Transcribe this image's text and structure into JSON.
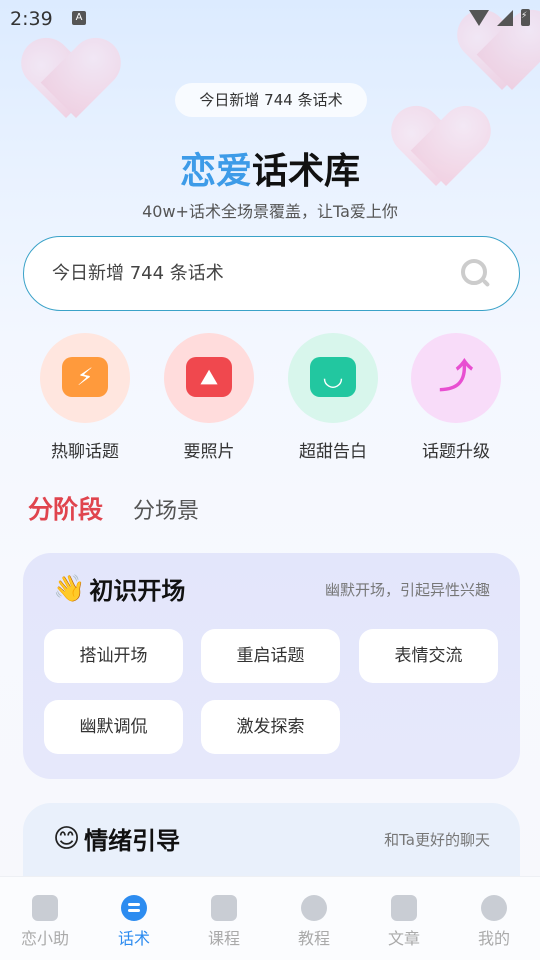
{
  "status_bar": {
    "time": "2:39",
    "indicator": "A"
  },
  "header": {
    "badge": "今日新增 744 条话术",
    "title_accent": "恋爱",
    "title_rest": "话术库",
    "subtitle": "40w+话术全场景覆盖，让Ta爱上你"
  },
  "search": {
    "placeholder": "今日新增 744 条话术"
  },
  "quick_actions": [
    {
      "label": "热聊话题",
      "icon": "lightning-chat-icon",
      "color": "#ff9a3c",
      "bg": "#ffe6df"
    },
    {
      "label": "要照片",
      "icon": "photo-icon",
      "color": "#f0484e",
      "bg": "#ffdcdc"
    },
    {
      "label": "超甜告白",
      "icon": "smile-chat-icon",
      "color": "#22c7a0",
      "bg": "#d8f6ec"
    },
    {
      "label": "话题升级",
      "icon": "upgrade-arrow-icon",
      "color": "#e84fd1",
      "bg": "#f8dcf9"
    }
  ],
  "tabs": {
    "active": "分阶段",
    "inactive": "分场景"
  },
  "section_opening": {
    "emoji": "👋",
    "title": "初识开场",
    "desc": "幽默开场，引起异性兴趣",
    "chips": [
      "搭讪开场",
      "重启话题",
      "表情交流",
      "幽默调侃",
      "激发探索"
    ]
  },
  "section_emotion": {
    "emoji": "😊",
    "title": "情绪引导",
    "desc": "和Ta更好的聊天"
  },
  "nav": [
    {
      "label": "恋小助",
      "icon": "home-icon",
      "active": false
    },
    {
      "label": "话术",
      "icon": "chat-icon",
      "active": true
    },
    {
      "label": "课程",
      "icon": "course-icon",
      "active": false
    },
    {
      "label": "教程",
      "icon": "compass-icon",
      "active": false
    },
    {
      "label": "文章",
      "icon": "article-icon",
      "active": false
    },
    {
      "label": "我的",
      "icon": "profile-icon",
      "active": false
    }
  ]
}
